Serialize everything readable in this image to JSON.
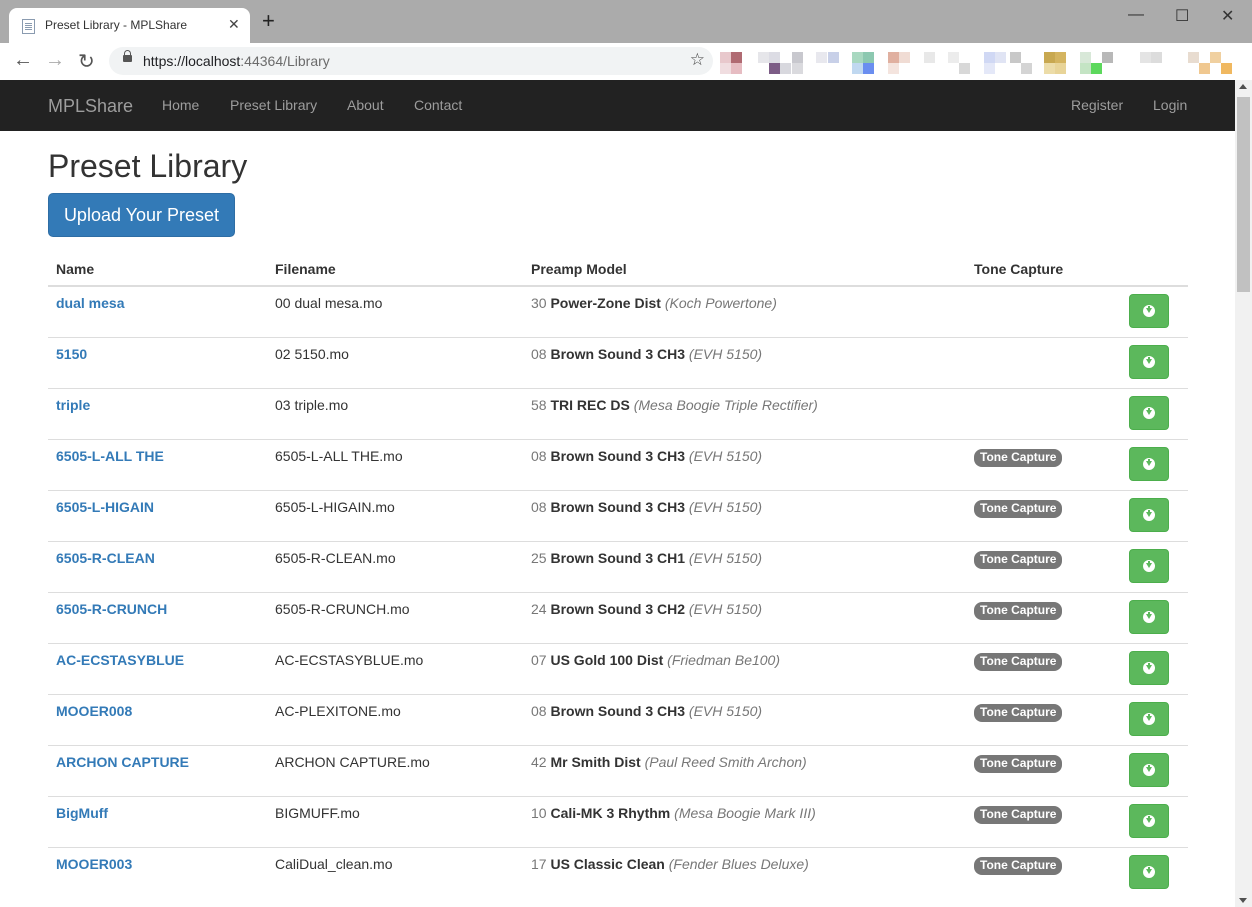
{
  "browser": {
    "tab_title": "Preset Library - MPLShare",
    "tab_close": "✕",
    "new_tab": "+",
    "url_host": "https://localhost",
    "url_rest": ":44364/Library",
    "minimize": "—",
    "maximize": "☐",
    "close": "✕"
  },
  "navbar": {
    "brand": "MPLShare",
    "links": [
      "Home",
      "Preset Library",
      "About",
      "Contact"
    ],
    "right_links": [
      "Register",
      "Login"
    ]
  },
  "page": {
    "title": "Preset Library",
    "upload_button": "Upload Your Preset"
  },
  "table": {
    "headers": [
      "Name",
      "Filename",
      "Preamp Model",
      "Tone Capture"
    ],
    "rows": [
      {
        "name": "dual mesa",
        "filename": "00 dual mesa.mo",
        "num": "30",
        "model": "Power-Zone Dist",
        "amp": "(Koch Powertone)",
        "tone_capture": ""
      },
      {
        "name": "5150",
        "filename": "02 5150.mo",
        "num": "08",
        "model": "Brown Sound 3 CH3",
        "amp": "(EVH 5150)",
        "tone_capture": ""
      },
      {
        "name": "triple",
        "filename": "03 triple.mo",
        "num": "58",
        "model": "TRI REC DS",
        "amp": "(Mesa Boogie Triple Rectifier)",
        "tone_capture": ""
      },
      {
        "name": "6505-L-ALL THE",
        "filename": "6505-L-ALL THE.mo",
        "num": "08",
        "model": "Brown Sound 3 CH3",
        "amp": "(EVH 5150)",
        "tone_capture": "Tone Capture"
      },
      {
        "name": "6505-L-HIGAIN",
        "filename": "6505-L-HIGAIN.mo",
        "num": "08",
        "model": "Brown Sound 3 CH3",
        "amp": "(EVH 5150)",
        "tone_capture": "Tone Capture"
      },
      {
        "name": "6505-R-CLEAN",
        "filename": "6505-R-CLEAN.mo",
        "num": "25",
        "model": "Brown Sound 3 CH1",
        "amp": "(EVH 5150)",
        "tone_capture": "Tone Capture"
      },
      {
        "name": "6505-R-CRUNCH",
        "filename": "6505-R-CRUNCH.mo",
        "num": "24",
        "model": "Brown Sound 3 CH2",
        "amp": "(EVH 5150)",
        "tone_capture": "Tone Capture"
      },
      {
        "name": "AC-ECSTASYBLUE",
        "filename": "AC-ECSTASYBLUE.mo",
        "num": "07",
        "model": "US Gold 100 Dist",
        "amp": "(Friedman Be100)",
        "tone_capture": "Tone Capture"
      },
      {
        "name": "MOOER008",
        "filename": "AC-PLEXITONE.mo",
        "num": "08",
        "model": "Brown Sound 3 CH3",
        "amp": "(EVH 5150)",
        "tone_capture": "Tone Capture"
      },
      {
        "name": "ARCHON CAPTURE",
        "filename": "ARCHON CAPTURE.mo",
        "num": "42",
        "model": "Mr Smith Dist",
        "amp": "(Paul Reed Smith Archon)",
        "tone_capture": "Tone Capture"
      },
      {
        "name": "BigMuff",
        "filename": "BIGMUFF.mo",
        "num": "10",
        "model": "Cali-MK 3 Rhythm",
        "amp": "(Mesa Boogie Mark III)",
        "tone_capture": "Tone Capture"
      },
      {
        "name": "MOOER003",
        "filename": "CaliDual_clean.mo",
        "num": "17",
        "model": "US Classic Clean",
        "amp": "(Fender Blues Deluxe)",
        "tone_capture": "Tone Capture"
      }
    ]
  },
  "colors": {
    "link": "#337ab7",
    "primary_button": "#337ab7",
    "download_button": "#5cb85c",
    "navbar": "#222222",
    "label": "#777777"
  }
}
